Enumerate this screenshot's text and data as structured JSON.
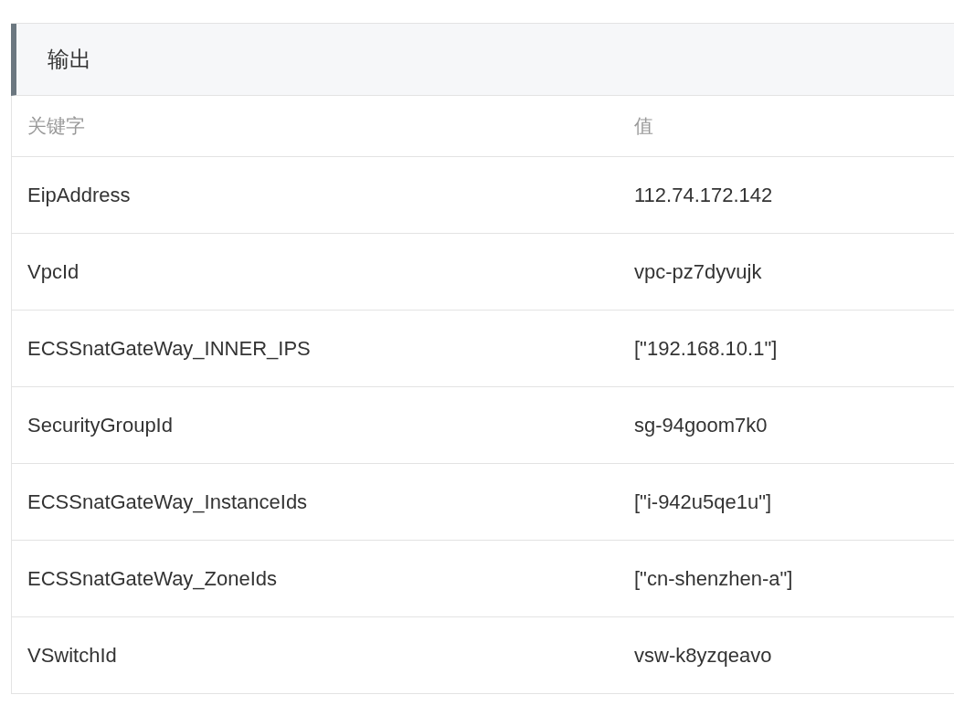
{
  "panel": {
    "title": "输出"
  },
  "table": {
    "columns": [
      "关键字",
      "值"
    ],
    "rows": [
      {
        "key": "EipAddress",
        "value": "112.74.172.142"
      },
      {
        "key": "VpcId",
        "value": "vpc-pz7dyvujk"
      },
      {
        "key": "ECSSnatGateWay_INNER_IPS",
        "value": "[\"192.168.10.1\"]"
      },
      {
        "key": "SecurityGroupId",
        "value": "sg-94goom7k0"
      },
      {
        "key": "ECSSnatGateWay_InstanceIds",
        "value": "[\"i-942u5qe1u\"]"
      },
      {
        "key": "ECSSnatGateWay_ZoneIds",
        "value": "[\"cn-shenzhen-a\"]"
      },
      {
        "key": "VSwitchId",
        "value": "vsw-k8yzqeavo"
      }
    ]
  }
}
